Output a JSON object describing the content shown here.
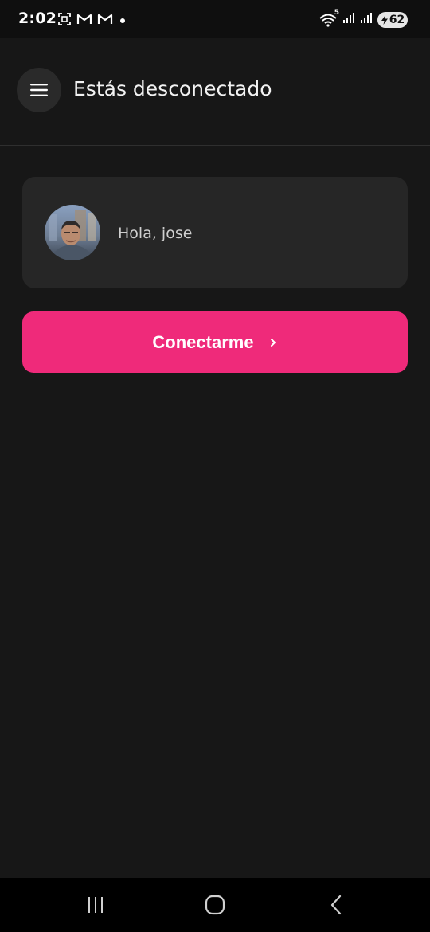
{
  "status_bar": {
    "time": "2:02",
    "battery_level": "62",
    "network_label": "5",
    "icons": [
      "screenshot-icon",
      "gmail-icon",
      "gmail-icon",
      "notification-dot-icon",
      "wifi-icon",
      "signal-icon",
      "signal-icon",
      "battery-icon"
    ]
  },
  "header": {
    "title": "Estás desconectado",
    "menu_icon": "hamburger-menu-icon"
  },
  "greeting_card": {
    "greeting": "Hola, jose",
    "avatar_icon": "user-avatar"
  },
  "connect_button": {
    "label": "Conectarme",
    "icon": "chevron-right-icon"
  },
  "nav_bar": {
    "icons": [
      "recent-apps-icon",
      "home-icon",
      "back-icon"
    ]
  },
  "colors": {
    "background": "#171717",
    "card": "#262626",
    "accent": "#ef2a7a",
    "status_bar": "#0f0f0f"
  }
}
